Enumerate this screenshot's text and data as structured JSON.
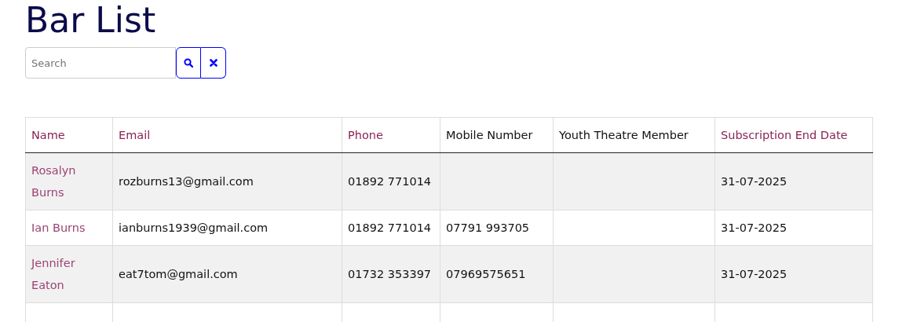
{
  "title": "Bar List",
  "search": {
    "placeholder": "Search"
  },
  "table": {
    "columns": [
      {
        "label": "Name",
        "sortable": true
      },
      {
        "label": "Email",
        "sortable": true
      },
      {
        "label": "Phone",
        "sortable": true
      },
      {
        "label": "Mobile Number",
        "sortable": false
      },
      {
        "label": "Youth Theatre Member",
        "sortable": false
      },
      {
        "label": "Subscription End Date",
        "sortable": true
      }
    ],
    "rows": [
      [
        "Rosalyn Burns",
        "rozburns13@gmail.com",
        "01892 771014",
        "",
        "",
        "31-07-2025"
      ],
      [
        "Ian Burns",
        "ianburns1939@gmail.com",
        "01892 771014",
        "07791 993705",
        "",
        "31-07-2025"
      ],
      [
        "Jennifer Eaton",
        "eat7tom@gmail.com",
        "01732 353397",
        "07969575651",
        "",
        "31-07-2025"
      ]
    ]
  }
}
